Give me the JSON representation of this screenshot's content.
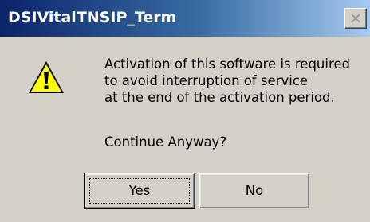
{
  "dialog": {
    "title": "DSIVitalTNSIP_Term",
    "icon": "warning-icon",
    "message_lines": [
      "Activation of this software is required",
      "to avoid interruption of service",
      "at the end of the activation period."
    ],
    "question": "Continue Anyway?",
    "buttons": {
      "yes_label": "Yes",
      "no_label": "No"
    }
  },
  "colors": {
    "titlebar_start": "#0a246a",
    "titlebar_end": "#a6caf0",
    "window_face": "#d4d0c8",
    "warning_fill": "#ffff00"
  }
}
